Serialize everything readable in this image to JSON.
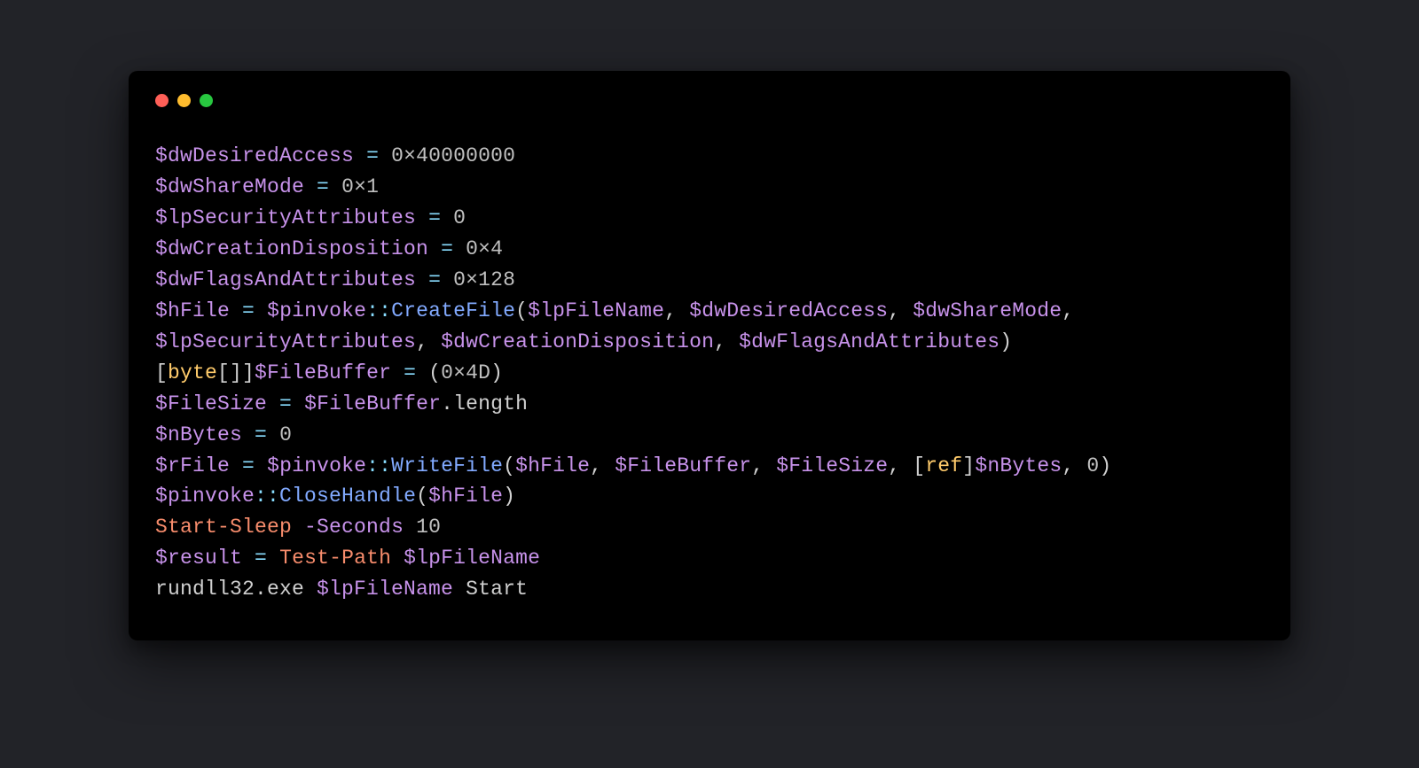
{
  "window": {
    "buttons": [
      "close",
      "minimize",
      "zoom"
    ]
  },
  "code": {
    "lines": [
      [
        {
          "t": "var",
          "v": "$dwDesiredAccess"
        },
        {
          "t": "plain",
          "v": " "
        },
        {
          "t": "op",
          "v": "="
        },
        {
          "t": "plain",
          "v": " "
        },
        {
          "t": "num",
          "v": "0×40000000"
        }
      ],
      [
        {
          "t": "var",
          "v": "$dwShareMode"
        },
        {
          "t": "plain",
          "v": " "
        },
        {
          "t": "op",
          "v": "="
        },
        {
          "t": "plain",
          "v": " "
        },
        {
          "t": "num",
          "v": "0×1"
        }
      ],
      [
        {
          "t": "var",
          "v": "$lpSecurityAttributes"
        },
        {
          "t": "plain",
          "v": " "
        },
        {
          "t": "op",
          "v": "="
        },
        {
          "t": "plain",
          "v": " "
        },
        {
          "t": "num",
          "v": "0"
        }
      ],
      [
        {
          "t": "var",
          "v": "$dwCreationDisposition"
        },
        {
          "t": "plain",
          "v": " "
        },
        {
          "t": "op",
          "v": "="
        },
        {
          "t": "plain",
          "v": " "
        },
        {
          "t": "num",
          "v": "0×4"
        }
      ],
      [
        {
          "t": "var",
          "v": "$dwFlagsAndAttributes"
        },
        {
          "t": "plain",
          "v": " "
        },
        {
          "t": "op",
          "v": "="
        },
        {
          "t": "plain",
          "v": " "
        },
        {
          "t": "num",
          "v": "0×128"
        }
      ],
      [
        {
          "t": "var",
          "v": "$hFile"
        },
        {
          "t": "plain",
          "v": " "
        },
        {
          "t": "op",
          "v": "="
        },
        {
          "t": "plain",
          "v": " "
        },
        {
          "t": "var",
          "v": "$pinvoke"
        },
        {
          "t": "op",
          "v": "::"
        },
        {
          "t": "func",
          "v": "CreateFile"
        },
        {
          "t": "punct",
          "v": "("
        },
        {
          "t": "var",
          "v": "$lpFileName"
        },
        {
          "t": "punct",
          "v": ", "
        },
        {
          "t": "var",
          "v": "$dwDesiredAccess"
        },
        {
          "t": "punct",
          "v": ", "
        },
        {
          "t": "var",
          "v": "$dwShareMode"
        },
        {
          "t": "punct",
          "v": ", "
        },
        {
          "t": "var",
          "v": "$lpSecurityAttributes"
        },
        {
          "t": "punct",
          "v": ", "
        },
        {
          "t": "var",
          "v": "$dwCreationDisposition"
        },
        {
          "t": "punct",
          "v": ", "
        },
        {
          "t": "var",
          "v": "$dwFlagsAndAttributes"
        },
        {
          "t": "punct",
          "v": ")"
        }
      ],
      [
        {
          "t": "punct",
          "v": "["
        },
        {
          "t": "type",
          "v": "byte"
        },
        {
          "t": "punct",
          "v": "[]]"
        },
        {
          "t": "var",
          "v": "$FileBuffer"
        },
        {
          "t": "plain",
          "v": " "
        },
        {
          "t": "op",
          "v": "="
        },
        {
          "t": "plain",
          "v": " "
        },
        {
          "t": "punct",
          "v": "("
        },
        {
          "t": "num",
          "v": "0×4D"
        },
        {
          "t": "punct",
          "v": ")"
        }
      ],
      [
        {
          "t": "var",
          "v": "$FileSize"
        },
        {
          "t": "plain",
          "v": " "
        },
        {
          "t": "op",
          "v": "="
        },
        {
          "t": "plain",
          "v": " "
        },
        {
          "t": "var",
          "v": "$FileBuffer"
        },
        {
          "t": "punct",
          "v": "."
        },
        {
          "t": "member",
          "v": "length"
        }
      ],
      [
        {
          "t": "var",
          "v": "$nBytes"
        },
        {
          "t": "plain",
          "v": " "
        },
        {
          "t": "op",
          "v": "="
        },
        {
          "t": "plain",
          "v": " "
        },
        {
          "t": "num",
          "v": "0"
        }
      ],
      [
        {
          "t": "var",
          "v": "$rFile"
        },
        {
          "t": "plain",
          "v": " "
        },
        {
          "t": "op",
          "v": "="
        },
        {
          "t": "plain",
          "v": " "
        },
        {
          "t": "var",
          "v": "$pinvoke"
        },
        {
          "t": "op",
          "v": "::"
        },
        {
          "t": "func",
          "v": "WriteFile"
        },
        {
          "t": "punct",
          "v": "("
        },
        {
          "t": "var",
          "v": "$hFile"
        },
        {
          "t": "punct",
          "v": ", "
        },
        {
          "t": "var",
          "v": "$FileBuffer"
        },
        {
          "t": "punct",
          "v": ", "
        },
        {
          "t": "var",
          "v": "$FileSize"
        },
        {
          "t": "punct",
          "v": ", ["
        },
        {
          "t": "type",
          "v": "ref"
        },
        {
          "t": "punct",
          "v": "]"
        },
        {
          "t": "var",
          "v": "$nBytes"
        },
        {
          "t": "punct",
          "v": ", "
        },
        {
          "t": "num",
          "v": "0"
        },
        {
          "t": "punct",
          "v": ")"
        }
      ],
      [
        {
          "t": "var",
          "v": "$pinvoke"
        },
        {
          "t": "op",
          "v": "::"
        },
        {
          "t": "func",
          "v": "CloseHandle"
        },
        {
          "t": "punct",
          "v": "("
        },
        {
          "t": "var",
          "v": "$hFile"
        },
        {
          "t": "punct",
          "v": ")"
        }
      ],
      [
        {
          "t": "cmd",
          "v": "Start-Sleep"
        },
        {
          "t": "plain",
          "v": " "
        },
        {
          "t": "flag",
          "v": "-Seconds"
        },
        {
          "t": "plain",
          "v": " "
        },
        {
          "t": "num",
          "v": "10"
        }
      ],
      [
        {
          "t": "var",
          "v": "$result"
        },
        {
          "t": "plain",
          "v": " "
        },
        {
          "t": "op",
          "v": "="
        },
        {
          "t": "plain",
          "v": " "
        },
        {
          "t": "cmd",
          "v": "Test-Path"
        },
        {
          "t": "plain",
          "v": " "
        },
        {
          "t": "var",
          "v": "$lpFileName"
        }
      ],
      [
        {
          "t": "plain",
          "v": "rundll32.exe "
        },
        {
          "t": "var",
          "v": "$lpFileName"
        },
        {
          "t": "plain",
          "v": " Start"
        }
      ]
    ]
  }
}
